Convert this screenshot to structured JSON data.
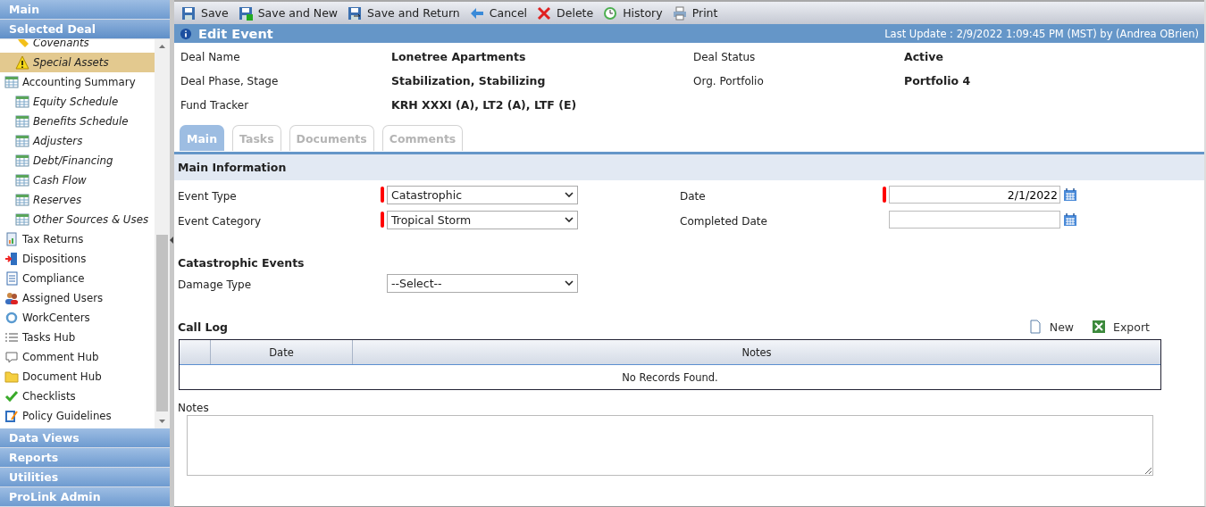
{
  "sidebar": {
    "top_headers": [
      {
        "label": "Main",
        "selected": false
      },
      {
        "label": "Selected Deal",
        "selected": true
      }
    ],
    "items": [
      {
        "children": [
          {
            "label": "Covenants",
            "kind": "tag",
            "selected": false
          },
          {
            "label": "Special Assets",
            "kind": "warning",
            "selected": true
          }
        ]
      },
      {
        "label": "Accounting Summary",
        "kind": "grid",
        "selected": false,
        "children": [
          {
            "label": "Equity Schedule",
            "kind": "grid",
            "selected": false
          },
          {
            "label": "Benefits Schedule",
            "kind": "grid",
            "selected": false
          },
          {
            "label": "Adjusters",
            "kind": "grid",
            "selected": false
          },
          {
            "label": "Debt/Financing",
            "kind": "grid",
            "selected": false
          },
          {
            "label": "Cash Flow",
            "kind": "grid",
            "selected": false
          },
          {
            "label": "Reserves",
            "kind": "grid",
            "selected": false
          },
          {
            "label": "Other Sources & Uses",
            "kind": "grid",
            "selected": false
          }
        ]
      },
      {
        "label": "Tax Returns",
        "kind": "report",
        "selected": false
      },
      {
        "label": "Dispositions",
        "kind": "exit",
        "selected": false
      },
      {
        "label": "Compliance",
        "kind": "document",
        "selected": false
      },
      {
        "label": "Assigned Users",
        "kind": "users",
        "selected": false
      },
      {
        "label": "WorkCenters",
        "kind": "ring",
        "selected": false
      },
      {
        "label": "Tasks Hub",
        "kind": "list",
        "selected": false
      },
      {
        "label": "Comment Hub",
        "kind": "comment",
        "selected": false
      },
      {
        "label": "Document Hub",
        "kind": "folder",
        "selected": false
      },
      {
        "label": "Checklists",
        "kind": "check",
        "selected": false
      },
      {
        "label": "Policy Guidelines",
        "kind": "pencil",
        "selected": false
      }
    ],
    "bottom_headers": [
      {
        "label": "Data Views",
        "selected": false
      },
      {
        "label": "Reports",
        "selected": false
      },
      {
        "label": "Utilities",
        "selected": false
      },
      {
        "label": "ProLink Admin",
        "selected": false
      }
    ]
  },
  "toolbar": [
    {
      "label": "Save",
      "kind": "save"
    },
    {
      "label": "Save and New",
      "kind": "save-new"
    },
    {
      "label": "Save and Return",
      "kind": "save-return"
    },
    {
      "label": "Cancel",
      "kind": "cancel"
    },
    {
      "label": "Delete",
      "kind": "delete"
    },
    {
      "label": "History",
      "kind": "history"
    },
    {
      "label": "Print",
      "kind": "print"
    }
  ],
  "title_bar": {
    "title": "Edit Event",
    "last_update": "Last Update : 2/9/2022 1:09:45 PM (MST) by (Andrea OBrien)"
  },
  "deal_info": [
    {
      "label": "Deal Name",
      "value": "Lonetree Apartments"
    },
    {
      "label": "Deal Status",
      "value": "Active"
    },
    {
      "label": "Deal Phase, Stage",
      "value": "Stabilization, Stabilizing"
    },
    {
      "label": "Org. Portfolio",
      "value": "Portfolio 4"
    },
    {
      "label": "Fund Tracker",
      "value": "KRH XXXI (A), LT2 (A), LTF (E)"
    }
  ],
  "tabs": [
    {
      "label": "Main",
      "selected": true
    },
    {
      "label": "Tasks",
      "selected": false
    },
    {
      "label": "Documents",
      "selected": false
    },
    {
      "label": "Comments",
      "selected": false
    }
  ],
  "main_information": {
    "title": "Main Information",
    "fields": [
      {
        "label": "Event Type",
        "kind": "select",
        "value": "Catastrophic",
        "required": true
      },
      {
        "label": "Date",
        "kind": "date",
        "value": "2/1/2022",
        "required": true
      },
      {
        "label": "Event Category",
        "kind": "select",
        "value": "Tropical Storm",
        "required": true
      },
      {
        "label": "Completed Date",
        "kind": "date",
        "required": false
      }
    ]
  },
  "catastrophic_events": {
    "title": "Catastrophic Events",
    "fields": [
      {
        "label": "Damage Type",
        "kind": "select",
        "value": "--Select--",
        "required": false
      }
    ]
  },
  "call_log": {
    "title": "Call Log",
    "actions": [
      {
        "label": "New",
        "kind": "new"
      },
      {
        "label": "Export",
        "kind": "export"
      }
    ],
    "columns": [
      "Date",
      "Notes"
    ],
    "empty_message": "No Records Found."
  },
  "notes": {
    "label": "Notes"
  }
}
